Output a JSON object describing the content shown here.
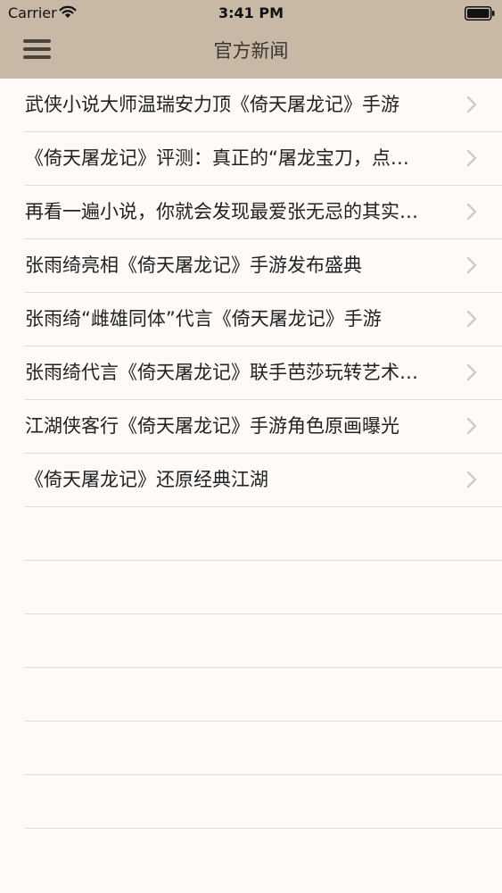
{
  "status_bar": {
    "carrier": "Carrier",
    "time": "3:41 PM"
  },
  "nav": {
    "title": "官方新闻",
    "menu_icon": "hamburger-menu-icon"
  },
  "news": [
    {
      "title": "武侠小说大师温瑞安力顶《倚天屠龙记》手游"
    },
    {
      "title": "《倚天屠龙记》评测：真正的“屠龙宝刀，点…"
    },
    {
      "title": "再看一遍小说，你就会发现最爱张无忌的其实…"
    },
    {
      "title": "张雨绮亮相《倚天屠龙记》手游发布盛典"
    },
    {
      "title": "张雨绮“雌雄同体”代言《倚天屠龙记》手游"
    },
    {
      "title": "张雨绮代言《倚天屠龙记》联手芭莎玩转艺术…"
    },
    {
      "title": "江湖侠客行《倚天屠龙记》手游角色原画曝光"
    },
    {
      "title": "《倚天屠龙记》还原经典江湖"
    }
  ],
  "colors": {
    "nav_background": "#c8b9a6",
    "page_background": "#fdfaf7",
    "separator": "#e1dcd6",
    "chevron": "#c7c7cc"
  }
}
